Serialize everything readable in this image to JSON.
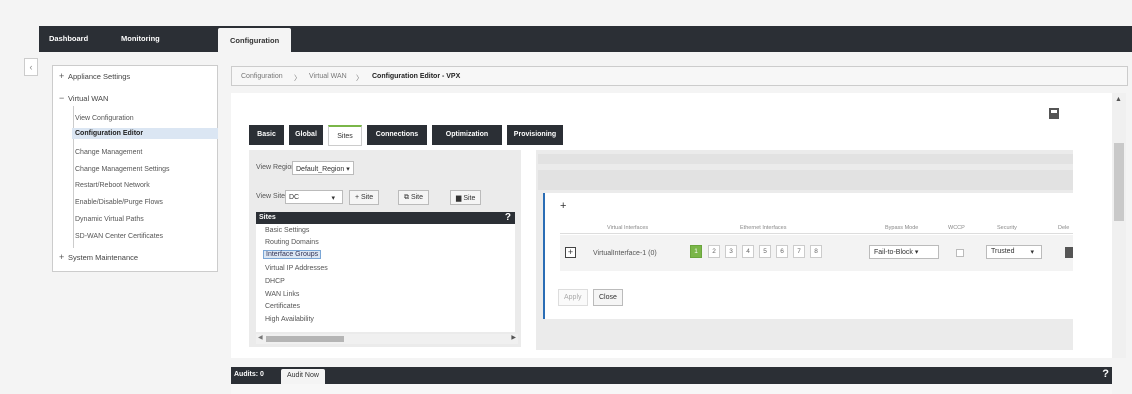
{
  "topnav": {
    "tabs": [
      "Dashboard",
      "Monitoring",
      "Configuration"
    ]
  },
  "sidebar": {
    "collapse_icon": "‹",
    "appliance_settings": "Appliance Settings",
    "virtual_wan": "Virtual WAN",
    "sub_items": [
      "View Configuration",
      "Configuration Editor",
      "Change Management",
      "Change Management Settings",
      "Restart/Reboot Network",
      "Enable/Disable/Purge Flows",
      "Dynamic Virtual Paths",
      "SD-WAN Center Certificates"
    ],
    "system_maintenance": "System Maintenance",
    "plus": "+",
    "minus": "−"
  },
  "breadcrumb": {
    "items": [
      "Configuration",
      "Virtual WAN",
      "Configuration Editor - VPX"
    ],
    "sep": "〉"
  },
  "editor": {
    "tabs": [
      "Basic",
      "Global",
      "Sites",
      "Connections",
      "Optimization",
      "Provisioning"
    ],
    "view_region_label": "View Region:",
    "view_region_value": "Default_Region ▾",
    "view_site_label": "View Site:",
    "view_site_value": "DC",
    "view_site_caret": "▾",
    "add_site": "+ Site",
    "clone_site": "Site",
    "delete_site": "Site",
    "sites_header": "Sites",
    "help": "?",
    "site_items": [
      "Basic Settings",
      "Routing Domains",
      "Interface Groups",
      "Virtual IP Addresses",
      "DHCP",
      "WAN Links",
      "Certificates",
      "High Availability"
    ]
  },
  "interface_table": {
    "add": "+",
    "headers": [
      "Virtual Interfaces",
      "Ethernet Interfaces",
      "Bypass Mode",
      "WCCP",
      "Security",
      "Dele"
    ],
    "row": {
      "expand": "+",
      "name": "VirtualInterface-1 (0)",
      "ports": [
        "1",
        "2",
        "3",
        "4",
        "5",
        "6",
        "7",
        "8"
      ],
      "selected_port": "1",
      "bypass_mode": "Fail-to-Block ▾",
      "security": "Trusted",
      "security_caret": "▾"
    },
    "apply": "Apply",
    "close": "Close"
  },
  "audits": {
    "label": "Audits: 0",
    "button": "Audit Now",
    "help": "?"
  },
  "colors": {
    "dark_nav": "#2b2f35",
    "accent_green": "#7ab648",
    "accent_blue": "#2a6db5"
  }
}
